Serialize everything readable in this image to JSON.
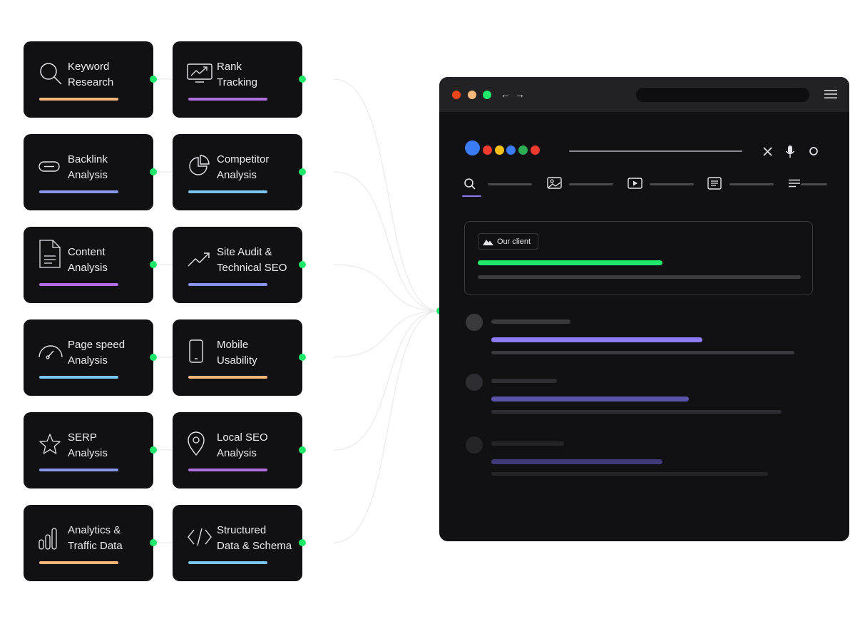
{
  "cards": [
    {
      "id": "keyword-research",
      "label": "Keyword\nResearch",
      "icon": "magnifier-icon",
      "accent": "#f9b779"
    },
    {
      "id": "rank-tracking",
      "label": "Rank\nTracking",
      "icon": "trend-monitor-icon",
      "accent": "#b26ee0"
    },
    {
      "id": "backlink-analysis",
      "label": "Backlink\nAnalysis",
      "icon": "link-icon",
      "accent": "#8897ee"
    },
    {
      "id": "competitor-analysis",
      "label": "Competitor\nAnalysis",
      "icon": "pie-chart-icon",
      "accent": "#78c6f0"
    },
    {
      "id": "content-analysis",
      "label": "Content\nAnalysis",
      "icon": "document-icon",
      "accent": "#b26ee0"
    },
    {
      "id": "site-audit",
      "label": "Site Audit &\nTechnical SEO",
      "icon": "trend-line-icon",
      "accent": "#8897ee"
    },
    {
      "id": "page-speed",
      "label": "Page speed\nAnalysis",
      "icon": "speedometer-icon",
      "accent": "#78c6f0"
    },
    {
      "id": "mobile-usability",
      "label": "Mobile\nUsability",
      "icon": "smartphone-icon",
      "accent": "#f9b779"
    },
    {
      "id": "serp-analysis",
      "label": "SERP\nAnalysis",
      "icon": "star-icon",
      "accent": "#8897ee"
    },
    {
      "id": "local-seo",
      "label": "Local SEO\nAnalysis",
      "icon": "map-pin-icon",
      "accent": "#b26ee0"
    },
    {
      "id": "analytics",
      "label": "Analytics &\nTraffic Data",
      "icon": "bar-chart-icon",
      "accent": "#f9b779"
    },
    {
      "id": "structured-data",
      "label": "Structured\nData & Schema",
      "icon": "code-brackets-icon",
      "accent": "#78c6f0"
    }
  ],
  "browser": {
    "traffic_lights": [
      "#f0461c",
      "#f9b779",
      "#1ee86a"
    ],
    "back_arrow": "←",
    "forward_arrow": "→",
    "search_tabs": [
      "search-icon",
      "image-icon",
      "video-icon",
      "news-icon",
      "more-icon"
    ],
    "client_badge": "Our client",
    "highlight_color": "#1ee86a"
  }
}
